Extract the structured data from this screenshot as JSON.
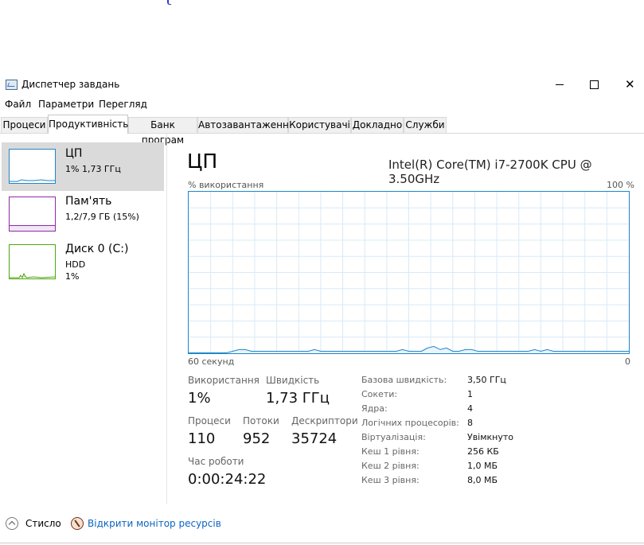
{
  "window": {
    "title": "Диспетчер завдань"
  },
  "menu": [
    "Файл",
    "Параметри",
    "Перегляд"
  ],
  "tabs": [
    {
      "label": "Процеси"
    },
    {
      "label": "Продуктивність",
      "active": true
    },
    {
      "label": "Банк програм"
    },
    {
      "label": "Автозавантаження"
    },
    {
      "label": "Користувачі"
    },
    {
      "label": "Докладно"
    },
    {
      "label": "Служби"
    }
  ],
  "sidebar": [
    {
      "name": "ЦП",
      "line1": "1% 1,73 ГГц",
      "line2": "",
      "color": "#1f86c8",
      "selected": true
    },
    {
      "name": "Пам'ять",
      "line1": "1,2/7,9 ГБ (15%)",
      "line2": "",
      "color": "#8b2ca5"
    },
    {
      "name": "Диск 0 (C:)",
      "line1": "HDD",
      "line2": "1%",
      "color": "#4da60c"
    }
  ],
  "main": {
    "title": "ЦП",
    "cpu_model": "Intel(R) Core(TM) i7-2700K CPU @ 3.50GHz",
    "usage_label": "% використання",
    "max_label": "100 %",
    "time_label": "60 секунд",
    "zero_label": "0",
    "graph_color": "#1f86c8",
    "grid_color": "#d9eaf6"
  },
  "chart_data": {
    "type": "line",
    "title": "",
    "xlabel": "60 секунд",
    "ylabel": "% використання",
    "xlim": [
      60,
      0
    ],
    "ylim": [
      0,
      100
    ],
    "series": [
      {
        "values": [
          0,
          0,
          0,
          0,
          0,
          0,
          0,
          1,
          2,
          2,
          1,
          1,
          1,
          1,
          1,
          1,
          1,
          1,
          1,
          1,
          2,
          1,
          1,
          1,
          1,
          1,
          1,
          1,
          1,
          1,
          1,
          1,
          1,
          1,
          2,
          1,
          1,
          1,
          3,
          4,
          2,
          3,
          1,
          1,
          2,
          2,
          1,
          1,
          1,
          1,
          1,
          1,
          1,
          1,
          1,
          2,
          1,
          2,
          1,
          1,
          1,
          1,
          1,
          1,
          1,
          1,
          1,
          1,
          1,
          1,
          1
        ]
      }
    ]
  },
  "stats": {
    "usage_label": "Використання",
    "usage_value": "1%",
    "speed_label": "Швидкість",
    "speed_value": "1,73 ГГц",
    "proc_label": "Процеси",
    "proc_value": "110",
    "threads_label": "Потоки",
    "threads_value": "952",
    "handles_label": "Дескриптори",
    "handles_value": "35724",
    "uptime_label": "Час роботи",
    "uptime_value": "0:00:24:22"
  },
  "details": [
    {
      "label": "Базова швидкість:",
      "value": "3,50 ГГц"
    },
    {
      "label": "Сокети:",
      "value": "1"
    },
    {
      "label": "Ядра:",
      "value": "4"
    },
    {
      "label": "Логічних процесорів:",
      "value": "8"
    },
    {
      "label": "Віртуалізація:",
      "value": "Увімкнуто"
    },
    {
      "label": "Кеш 1 рівня:",
      "value": "256 КБ"
    },
    {
      "label": "Кеш 2 рівня:",
      "value": "1,0 МБ"
    },
    {
      "label": "Кеш 3 рівня:",
      "value": "8,0 МБ"
    }
  ],
  "footer": {
    "less_label": "Стисло",
    "monitor_link": "Відкрити монітор ресурсів"
  }
}
